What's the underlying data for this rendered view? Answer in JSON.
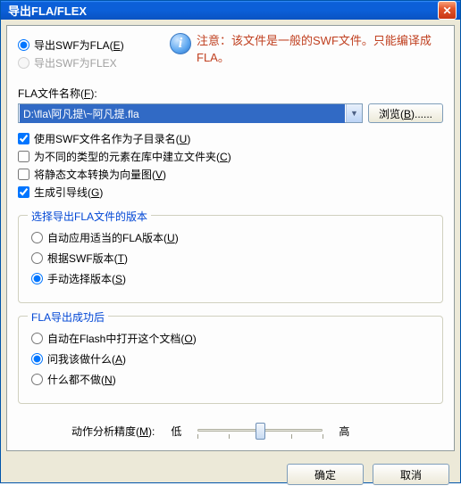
{
  "window": {
    "title": "导出FLA/FLEX"
  },
  "exportType": {
    "fla": {
      "label": "导出SWF为FLA",
      "hotkey": "E"
    },
    "flex": {
      "label": "导出SWF为FLEX"
    }
  },
  "notice": "注意：该文件是一般的SWF文件。只能编译成FLA。",
  "fileLabel": {
    "text": "FLA文件名称",
    "hotkey": "F"
  },
  "filePath": "D:\\fla\\阿凡提\\~阿凡提.fla",
  "browse": {
    "label": "浏览",
    "hotkey": "B",
    "suffix": "......"
  },
  "checks": {
    "useSwfName": {
      "label": "使用SWF文件名作为子目录名",
      "hotkey": "U",
      "checked": true
    },
    "createFolder": {
      "label": "为不同的类型的元素在库中建立文件夹",
      "hotkey": "C",
      "checked": false
    },
    "convertVec": {
      "label": "将静态文本转换为向量图",
      "hotkey": "V",
      "checked": false
    },
    "guides": {
      "label": "生成引导线",
      "hotkey": "G",
      "checked": true
    }
  },
  "versionGroup": {
    "title": "选择导出FLA文件的版本",
    "auto": {
      "label": "自动应用适当的FLA版本",
      "hotkey": "U"
    },
    "bySwf": {
      "label": "根据SWF版本",
      "hotkey": "T"
    },
    "manual": {
      "label": "手动选择版本",
      "hotkey": "S"
    }
  },
  "afterGroup": {
    "title": "FLA导出成功后",
    "open": {
      "label": "自动在Flash中打开这个文档",
      "hotkey": "O"
    },
    "ask": {
      "label": "问我该做什么",
      "hotkey": "A"
    },
    "none": {
      "label": "什么都不做",
      "hotkey": "N"
    }
  },
  "slider": {
    "label": "动作分析精度",
    "hotkey": "M",
    "low": "低",
    "high": "高"
  },
  "buttons": {
    "ok": "确定",
    "cancel": "取消"
  }
}
